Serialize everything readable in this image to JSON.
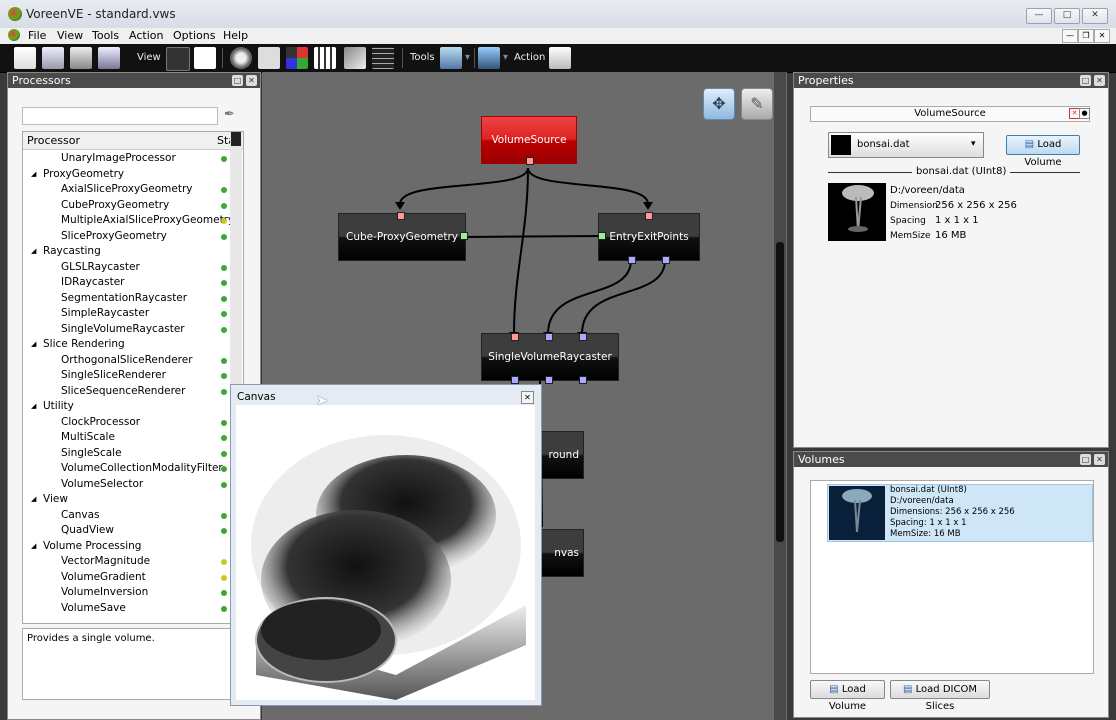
{
  "window": {
    "title": "VoreenVE  - standard.vws"
  },
  "menu": [
    "File",
    "View",
    "Tools",
    "Action",
    "Options",
    "Help"
  ],
  "toolbar": {
    "view_label": "View",
    "tools_label": "Tools",
    "action_label": "Action"
  },
  "processors_panel": {
    "title": "Processors",
    "col_processor": "Processor",
    "col_state": "Sta",
    "description": "Provides a single volume.",
    "rows": [
      {
        "label": "UnaryImageProcessor",
        "level": 1,
        "status": "#3aa832"
      },
      {
        "label": "ProxyGeometry",
        "level": 0,
        "status": ""
      },
      {
        "label": "AxialSliceProxyGeometry",
        "level": 1,
        "status": "#3aa832"
      },
      {
        "label": "CubeProxyGeometry",
        "level": 1,
        "status": "#3aa832"
      },
      {
        "label": "MultipleAxialSliceProxyGeometry",
        "level": 1,
        "status": "#c8c820"
      },
      {
        "label": "SliceProxyGeometry",
        "level": 1,
        "status": "#3aa832"
      },
      {
        "label": "Raycasting",
        "level": 0,
        "status": ""
      },
      {
        "label": "GLSLRaycaster",
        "level": 1,
        "status": "#3aa832"
      },
      {
        "label": "IDRaycaster",
        "level": 1,
        "status": "#3aa832"
      },
      {
        "label": "SegmentationRaycaster",
        "level": 1,
        "status": "#3aa832"
      },
      {
        "label": "SimpleRaycaster",
        "level": 1,
        "status": "#3aa832"
      },
      {
        "label": "SingleVolumeRaycaster",
        "level": 1,
        "status": "#3aa832"
      },
      {
        "label": "Slice Rendering",
        "level": 0,
        "status": ""
      },
      {
        "label": "OrthogonalSliceRenderer",
        "level": 1,
        "status": "#3aa832"
      },
      {
        "label": "SingleSliceRenderer",
        "level": 1,
        "status": "#3aa832"
      },
      {
        "label": "SliceSequenceRenderer",
        "level": 1,
        "status": "#3aa832"
      },
      {
        "label": "Utility",
        "level": 0,
        "status": ""
      },
      {
        "label": "ClockProcessor",
        "level": 1,
        "status": "#3aa832"
      },
      {
        "label": "MultiScale",
        "level": 1,
        "status": "#3aa832"
      },
      {
        "label": "SingleScale",
        "level": 1,
        "status": "#3aa832"
      },
      {
        "label": "VolumeCollectionModalityFilter",
        "level": 1,
        "status": "#3aa832"
      },
      {
        "label": "VolumeSelector",
        "level": 1,
        "status": "#3aa832"
      },
      {
        "label": "View",
        "level": 0,
        "status": ""
      },
      {
        "label": "Canvas",
        "level": 1,
        "status": "#3aa832"
      },
      {
        "label": "QuadView",
        "level": 1,
        "status": "#3aa832"
      },
      {
        "label": "Volume Processing",
        "level": 0,
        "status": ""
      },
      {
        "label": "VectorMagnitude",
        "level": 1,
        "status": "#c8c820"
      },
      {
        "label": "VolumeGradient",
        "level": 1,
        "status": "#c8c820"
      },
      {
        "label": "VolumeInversion",
        "level": 1,
        "status": "#3aa832"
      },
      {
        "label": "VolumeSave",
        "level": 1,
        "status": "#3aa832"
      }
    ]
  },
  "network": {
    "nodes": {
      "volume_source": "VolumeSource",
      "cube_proxy": "Cube-ProxyGeometry",
      "entry_exit": "EntryExitPoints",
      "raycaster": "SingleVolumeRaycaster",
      "background_partial": "round",
      "canvas_partial": "nvas"
    }
  },
  "canvas_window": {
    "title": "Canvas"
  },
  "properties": {
    "title": "Properties",
    "group_title": "VolumeSource",
    "selected_file": "bonsai.dat",
    "load_button": "Load Volume",
    "volume_header": "bonsai.dat (UInt8)",
    "path": "D:/voreen/data",
    "dimension_label": "Dimension",
    "dimension_value": "256 x 256 x 256",
    "spacing_label": "Spacing",
    "spacing_value": "1 x 1 x 1",
    "memsize_label": "MemSize",
    "memsize_value": "16 MB"
  },
  "volumes": {
    "title": "Volumes",
    "item": {
      "name": "bonsai.dat (UInt8)",
      "path": "D:/voreen/data",
      "dimensions": "Dimensions: 256 x 256 x 256",
      "spacing": "Spacing: 1 x 1 x 1",
      "memsize": "MemSize: 16 MB"
    },
    "load_volume": "Load Volume",
    "load_dicom": "Load DICOM Slices"
  }
}
